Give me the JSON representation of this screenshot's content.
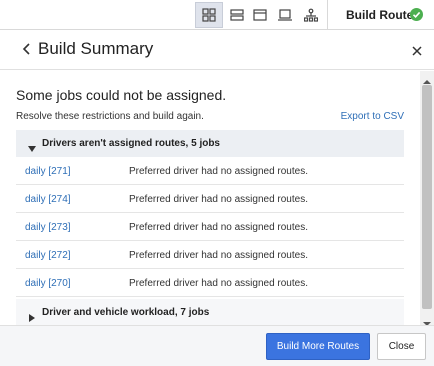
{
  "toolbar": {
    "icons": [
      "grid-view-icon",
      "list-view-icon",
      "window-view-icon",
      "laptop-view-icon",
      "tree-view-icon"
    ],
    "active_icon": "grid-view-icon",
    "build_routes_label": "Build Routes",
    "status_icon": "check-circle-icon",
    "status_color": "#4caf50"
  },
  "panel": {
    "title": "Build Summary",
    "back_icon": "chevron-left-icon",
    "close_icon": "close-icon"
  },
  "content": {
    "heading": "Some jobs could not be assigned.",
    "subtext": "Resolve these restrictions and build again.",
    "export_label": "Export to CSV",
    "groups": [
      {
        "title": "Drivers aren't assigned routes, 5 jobs",
        "expanded": true,
        "rows": [
          {
            "job": "daily [271]",
            "reason": "Preferred driver had no assigned routes."
          },
          {
            "job": "daily [274]",
            "reason": "Preferred driver had no assigned routes."
          },
          {
            "job": "daily [273]",
            "reason": "Preferred driver had no assigned routes."
          },
          {
            "job": "daily [272]",
            "reason": "Preferred driver had no assigned routes."
          },
          {
            "job": "daily [270]",
            "reason": "Preferred driver had no assigned routes."
          }
        ]
      },
      {
        "title": "Driver and vehicle workload, 7 jobs",
        "expanded": false,
        "rows": []
      }
    ]
  },
  "footer": {
    "primary_label": "Build More Routes",
    "secondary_label": "Close"
  },
  "colors": {
    "accent": "#3b74e0",
    "link": "#2f6fb7",
    "group_bg": "#eceff3"
  }
}
